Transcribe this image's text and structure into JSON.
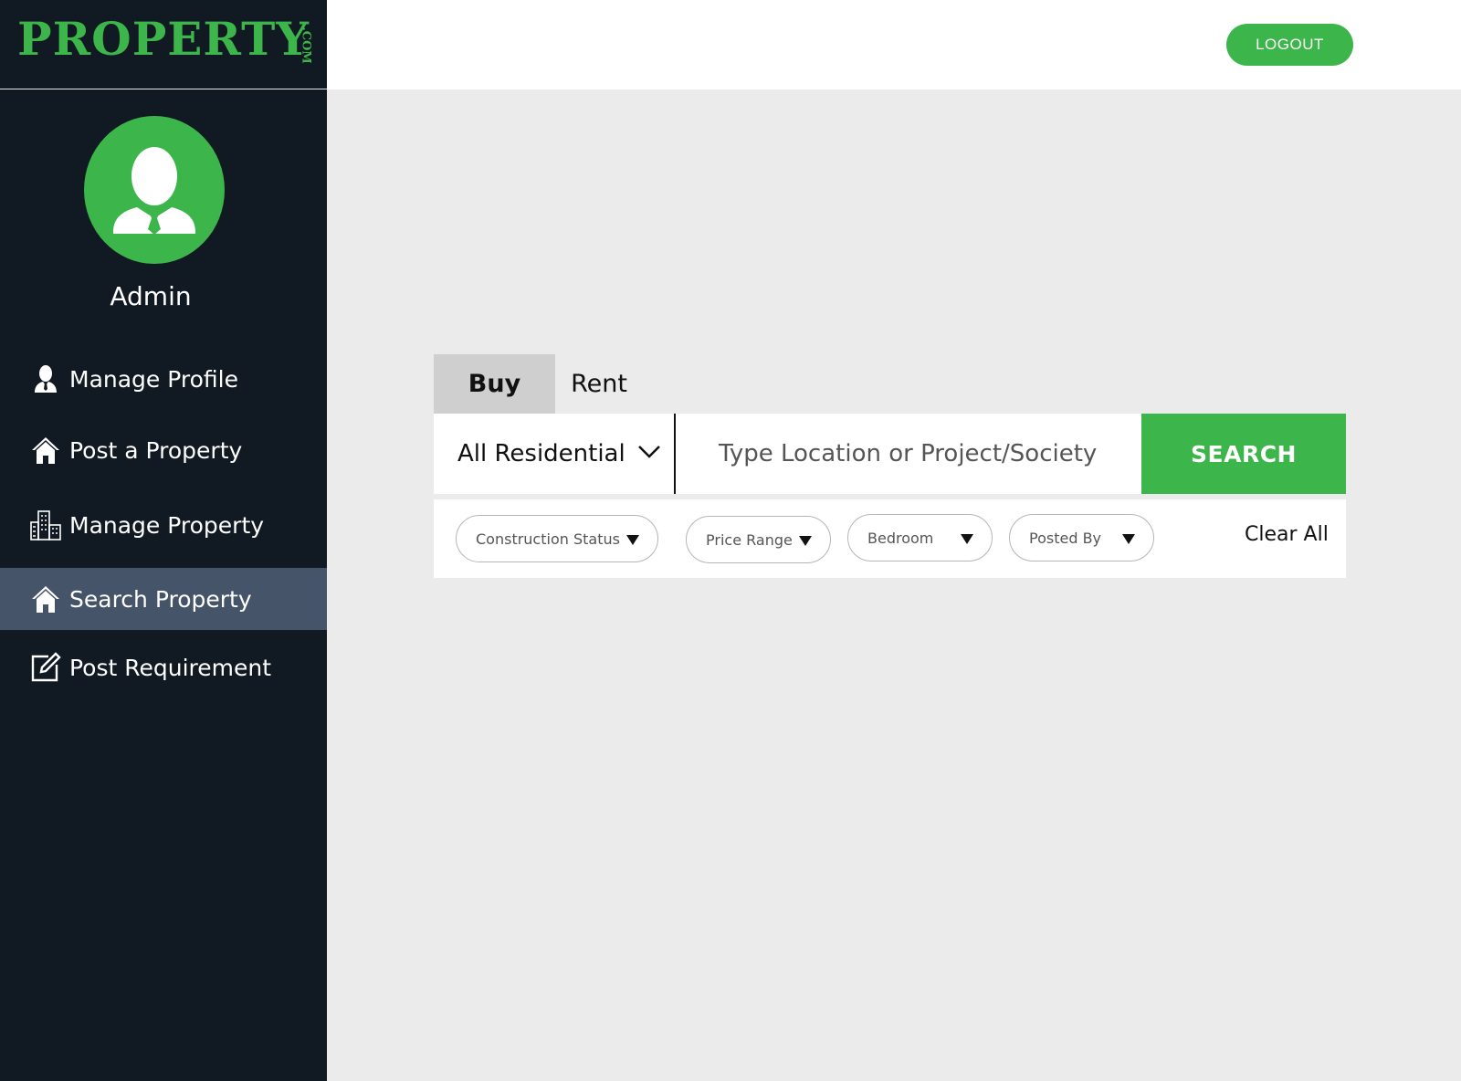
{
  "brand": {
    "name": "PROPERTY",
    "suffix": ".COM"
  },
  "user": {
    "name": "Admin"
  },
  "sidebar": {
    "items": [
      {
        "label": "Manage Profile",
        "icon": "user-icon",
        "active": false
      },
      {
        "label": "Post a Property",
        "icon": "home-icon",
        "active": false
      },
      {
        "label": "Manage Property",
        "icon": "buildings-icon",
        "active": false
      },
      {
        "label": "Search Property",
        "icon": "home-icon",
        "active": true
      },
      {
        "label": "Post Requirement",
        "icon": "edit-icon",
        "active": false
      }
    ]
  },
  "header": {
    "logout_label": "LOGOUT"
  },
  "search": {
    "tabs": [
      {
        "label": "Buy",
        "selected": true
      },
      {
        "label": "Rent",
        "selected": false
      }
    ],
    "category": "All Residential",
    "placeholder": "Type Location or Project/Society",
    "button_label": "SEARCH"
  },
  "filters": {
    "items": [
      "Construction Status",
      "Price Range",
      "Bedroom",
      "Posted By"
    ],
    "clear_label": "Clear All"
  },
  "colors": {
    "brand_green": "#3cb54a",
    "sidebar_bg": "#111923",
    "active_item_bg": "#465469",
    "page_bg": "#ebebeb"
  }
}
